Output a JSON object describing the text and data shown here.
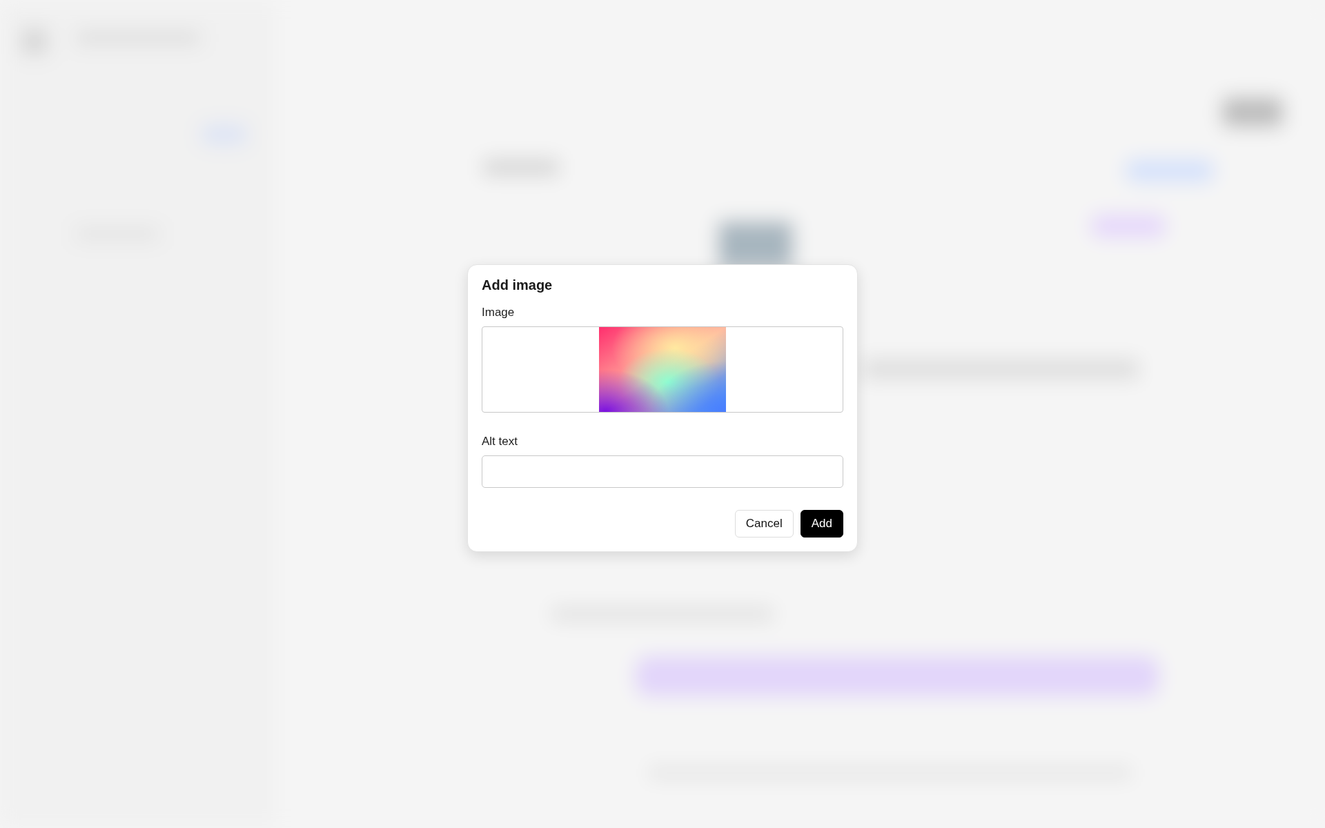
{
  "dialog": {
    "title": "Add image",
    "image_field": {
      "label": "Image"
    },
    "alt_field": {
      "label": "Alt text"
    },
    "buttons": [
      {
        "label": "Cancel",
        "kind": "secondary"
      },
      {
        "label": "Add",
        "kind": "primary"
      }
    ]
  }
}
